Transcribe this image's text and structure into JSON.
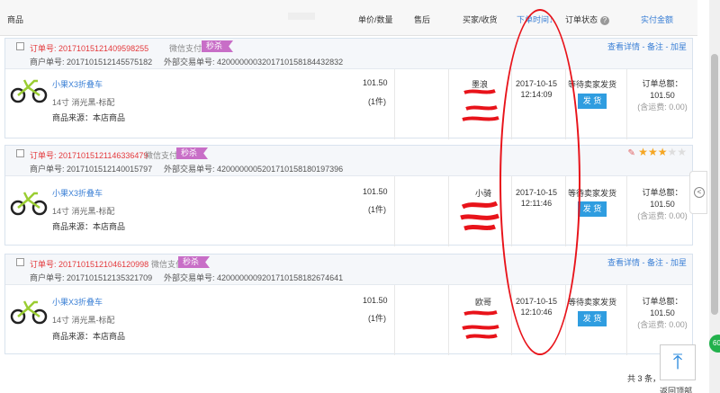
{
  "header": {
    "product": "商品",
    "price_qty": "单价/数量",
    "after_sale": "售后",
    "buyer_recv": "买家/收货",
    "order_time": "下单时间↓",
    "order_status": "订单状态",
    "paid_amount": "实付金额"
  },
  "icons": {
    "help": "question-mark-icon",
    "star": "star-icon",
    "back": "arrow-left-icon",
    "top": "arrow-up-icon",
    "pencil": "eraser-icon"
  },
  "colors": {
    "order_no": "#e4393c",
    "link": "#3a7fd5",
    "tag": "#c86ec7",
    "ship_button": "#2f9de0",
    "annotation": "#e8131a"
  },
  "orders": [
    {
      "order_no": "订单号: 20171015121409598255",
      "pay_method": "微信支付",
      "tag": "秒杀",
      "merchant_no": "商户单号: 2017101512145575182",
      "ext_no": "外部交易单号: 4200000003201710158184432832",
      "ops": "查看详情 - 备注 - 加星",
      "product_name": "小果X3折叠车",
      "spec": "14寸 消光黑-标配",
      "source": "商品来源：本店商品",
      "price": "101.50",
      "qty": "(1件)",
      "buyer": "墨浪",
      "date": "2017-10-15",
      "time": "12:14:09",
      "status": "等待卖家发货",
      "ship": "发 货",
      "total_label": "订单总额：",
      "total": "101.50",
      "freight": "(含运费: 0.00)"
    },
    {
      "order_no": "订单号: 20171015121146336479",
      "pay_method": "微信支付",
      "tag": "秒杀",
      "merchant_no": "商户单号: 2017101512140015797",
      "ext_no": "外部交易单号: 4200000005201710158180197396",
      "stars": 3,
      "stars_max": 5,
      "product_name": "小果X3折叠车",
      "spec": "14寸 消光黑-标配",
      "source": "商品来源：本店商品",
      "price": "101.50",
      "qty": "(1件)",
      "buyer": "小骑",
      "date": "2017-10-15",
      "time": "12:11:46",
      "status": "等待卖家发货",
      "ship": "发 货",
      "total_label": "订单总额：",
      "total": "101.50",
      "freight": "(含运费: 0.00)"
    },
    {
      "order_no": "订单号: 20171015121046120998",
      "pay_method": "微信支付",
      "tag": "秒杀",
      "merchant_no": "商户单号: 2017101512135321709",
      "ext_no": "外部交易单号: 4200000009201710158182674641",
      "ops": "查看详情 - 备注 - 加星",
      "product_name": "小果X3折叠车",
      "spec": "14寸 消光黑-标配",
      "source": "商品来源：本店商品",
      "price": "101.50",
      "qty": "(1件)",
      "buyer": "欧哥",
      "date": "2017-10-15",
      "time": "12:10:46",
      "status": "等待卖家发货",
      "ship": "发 货",
      "total_label": "订单总额：",
      "total": "101.50",
      "freight": "(含运费: 0.00)"
    }
  ],
  "footer": {
    "count": "共 3 条，",
    "back_top": "返回顶部"
  },
  "badge": "60"
}
